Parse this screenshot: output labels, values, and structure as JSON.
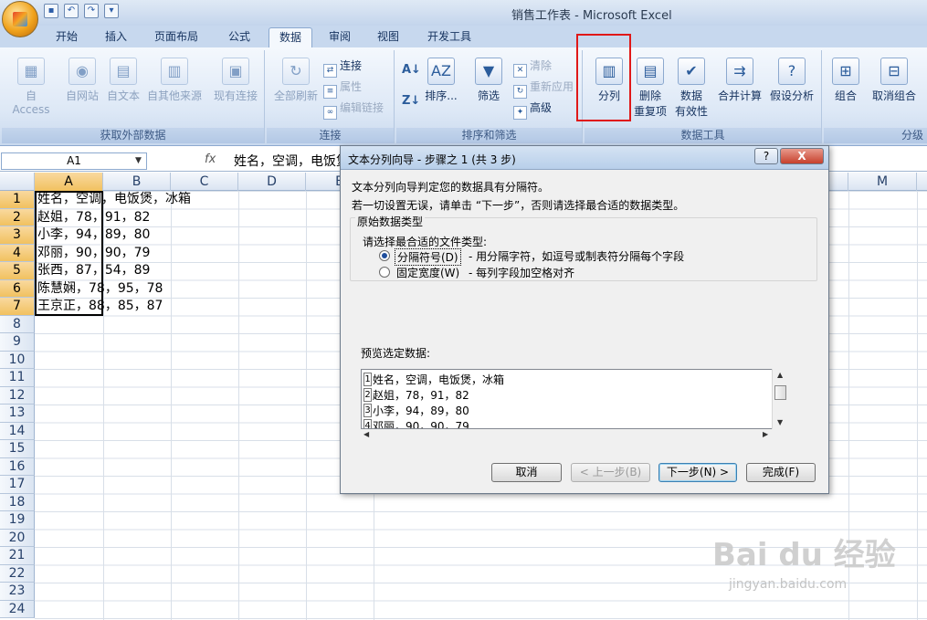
{
  "app": {
    "title": "销售工作表 - Microsoft Excel"
  },
  "tabs": [
    "开始",
    "插入",
    "页面布局",
    "公式",
    "数据",
    "审阅",
    "视图",
    "开发工具"
  ],
  "active_tab": "数据",
  "ribbon": {
    "get_external": {
      "label": "获取外部数据",
      "buttons": [
        "自 Access",
        "自网站",
        "自文本",
        "自其他来源",
        "现有连接"
      ]
    },
    "connections": {
      "label": "连接",
      "refresh": "全部刷新",
      "items": [
        "连接",
        "属性",
        "编辑链接"
      ]
    },
    "sort_filter": {
      "label": "排序和筛选",
      "sort": "排序...",
      "filter": "筛选",
      "items": [
        "清除",
        "重新应用",
        "高级"
      ]
    },
    "data_tools": {
      "label": "数据工具",
      "split": "分列",
      "remove_dup": [
        "删除",
        "重复项"
      ],
      "validation": [
        "数据",
        "有效性"
      ],
      "consolidate": "合并计算",
      "whatif": "假设分析"
    },
    "outline": {
      "label": "分级",
      "group": "组合",
      "ungroup": "取消组合"
    }
  },
  "formula_bar": {
    "name_box": "A1",
    "fx": "fx",
    "content": "姓名，空调，电饭煲，冰箱"
  },
  "columns": [
    "A",
    "B",
    "C",
    "D",
    "E",
    "M"
  ],
  "rows": [
    "1",
    "2",
    "3",
    "4",
    "5",
    "6",
    "7",
    "8",
    "9",
    "10",
    "11",
    "12",
    "13",
    "14",
    "15",
    "16",
    "17",
    "18",
    "19",
    "20",
    "21",
    "22",
    "23",
    "24"
  ],
  "cells": [
    "姓名，空调，电饭煲，冰箱",
    "赵姐，78，91，82",
    "小李，94，89，80",
    "邓丽，90，90，79",
    "张西，87，54，89",
    "陈慧娴，78，95，78",
    "王京正，88，85，87"
  ],
  "dialog": {
    "title": "文本分列向导 - 步骤之 1 (共 3 步)",
    "help": "?",
    "close": "X",
    "line1": "文本分列向导判定您的数据具有分隔符。",
    "line2": "若一切设置无误，请单击 “下一步”，否则请选择最合适的数据类型。",
    "group_title": "原始数据类型",
    "prompt": "请选择最合适的文件类型:",
    "opt1": "分隔符号(D)",
    "opt1_desc": "- 用分隔字符，如逗号或制表符分隔每个字段",
    "opt2": "固定宽度(W)",
    "opt2_desc": "- 每列字段加空格对齐",
    "preview_label": "预览选定数据:",
    "preview_rows": [
      {
        "n": "1",
        "t": "姓名，空调，电饭煲，冰箱"
      },
      {
        "n": "2",
        "t": "赵姐，78，91，82"
      },
      {
        "n": "3",
        "t": "小李，94，89，80"
      },
      {
        "n": "4",
        "t": "邓丽，90，90，79"
      }
    ],
    "buttons": {
      "cancel": "取消",
      "back": "< 上一步(B)",
      "next": "下一步(N) >",
      "finish": "完成(F)"
    }
  },
  "watermark": {
    "brand": "Bai du 经验",
    "url": "jingyan.baidu.com"
  }
}
